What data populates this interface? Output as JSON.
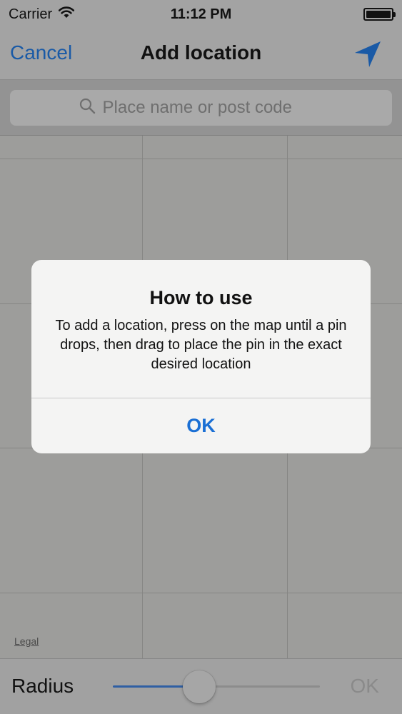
{
  "status_bar": {
    "carrier": "Carrier",
    "time": "11:12 PM",
    "wifi_icon": "wifi-icon",
    "battery_icon": "battery-icon"
  },
  "nav": {
    "cancel_label": "Cancel",
    "title": "Add location",
    "location_icon": "location-arrow-icon",
    "accent_color": "#1a5aa6"
  },
  "search": {
    "icon": "search-icon",
    "placeholder": "Place name or post code",
    "value": ""
  },
  "map": {
    "legal_label": "Legal"
  },
  "alert": {
    "title": "How to use",
    "message": "To add a location, press on the map until a pin drops, then drag to place the pin in the exact desired location",
    "ok_label": "OK"
  },
  "bottom_bar": {
    "radius_label": "Radius",
    "slider_value_fraction": 0.41,
    "ok_label": "OK"
  }
}
